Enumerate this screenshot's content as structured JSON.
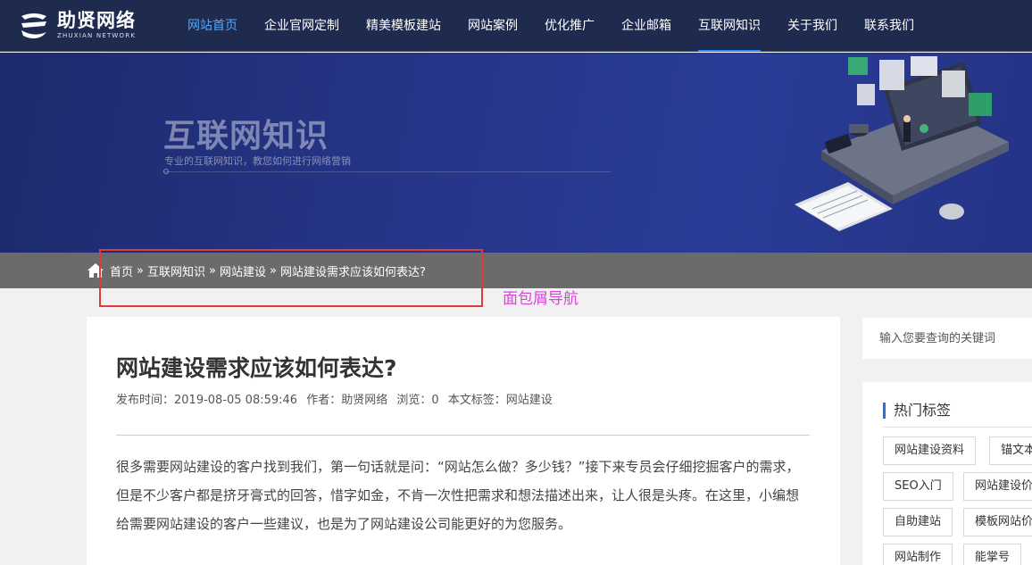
{
  "header": {
    "logo_cn": "助贤网络",
    "logo_en": "ZHUXIAN NETWORK",
    "nav": [
      {
        "label": "网站首页"
      },
      {
        "label": "企业官网定制"
      },
      {
        "label": "精美模板建站"
      },
      {
        "label": "网站案例"
      },
      {
        "label": "优化推广"
      },
      {
        "label": "企业邮箱"
      },
      {
        "label": "互联网知识"
      },
      {
        "label": "关于我们"
      },
      {
        "label": "联系我们"
      }
    ]
  },
  "banner": {
    "title": "互联网知识",
    "subtitle": "专业的互联网知识，教您如何进行网络营销"
  },
  "breadcrumb": {
    "items": [
      "首页",
      "互联网知识",
      "网站建设",
      "网站建设需求应该如何表达?"
    ],
    "separator": "»"
  },
  "annotation": {
    "label": "面包屑导航"
  },
  "article": {
    "title": "网站建设需求应该如何表达?",
    "meta": {
      "publish": "发布时间：2019-08-05 08:59:46",
      "author": "作者：助贤网络",
      "views": "浏览：0",
      "tags": "本文标签：网站建设"
    },
    "paragraph": "很多需要网站建设的客户找到我们，第一句话就是问：“网站怎么做？多少钱？”接下来专员会仔细挖掘客户的需求，但是不少客户都是挤牙膏式的回答，惜字如金，不肯一次性把需求和想法描述出来，让人很是头疼。在这里，小编想给需要网站建设的客户一些建议，也是为了网站建设公司能更好的为您服务。"
  },
  "sidebar": {
    "search_placeholder": "输入您要查询的关键词",
    "tags_title": "热门标签",
    "tags": [
      "网站建设资料",
      "锚文本",
      "SEO入门",
      "网站建设价",
      "自助建站",
      "模板网站价",
      "网站制作",
      "能掌号"
    ]
  },
  "colors": {
    "header_bg": "#1f2a4f",
    "nav_active": "#4fa9ff",
    "banner_bg": "#27368a",
    "crumb_bar": "#6b6b6b",
    "annotation_box": "#e03a3a",
    "annotation_text": "#e040e0",
    "tag_accent": "#2d6fd6"
  }
}
